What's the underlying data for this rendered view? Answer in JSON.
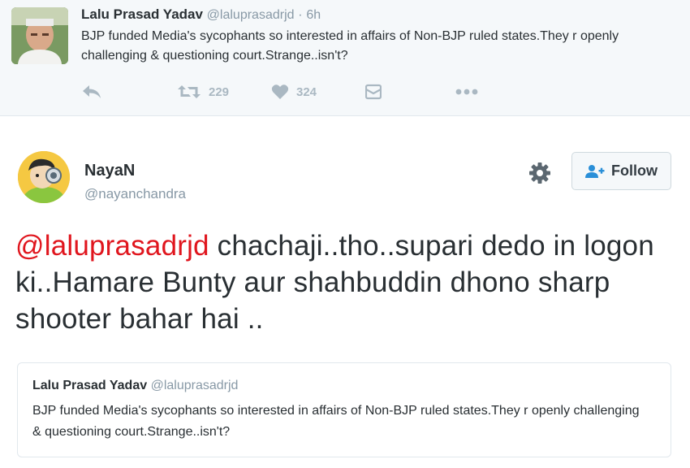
{
  "top_tweet": {
    "name": "Lalu Prasad Yadav",
    "handle": "@laluprasadrjd",
    "separator": "·",
    "time": "6h",
    "text": "BJP funded Media's sycophants so interested in affairs of Non-BJP ruled states.They r openly challenging & questioning court.Strange..isn't?",
    "actions": {
      "reply_icon": "reply-icon",
      "retweet_icon": "retweet-icon",
      "retweet_count": "229",
      "like_icon": "heart-icon",
      "like_count": "324",
      "dm_icon": "direct-message-icon",
      "more_icon": "more-icon"
    }
  },
  "main_tweet": {
    "name": "NayaN",
    "handle": "@nayanchandra",
    "mention": "@laluprasadrjd",
    "text": " chachaji..tho..supari dedo in logon ki..Hamare Bunty aur shahbuddin dhono sharp shooter bahar hai ..",
    "gear_icon": "gear-icon",
    "follow_label": "Follow",
    "follow_icon": "add-user-icon"
  },
  "quoted_tweet": {
    "name": "Lalu Prasad Yadav",
    "handle": "@laluprasadrjd",
    "text": "BJP funded Media's sycophants so interested in affairs of Non-BJP ruled states.They r openly challenging & questioning court.Strange..isn't?"
  },
  "colors": {
    "mention": "#e0161e",
    "muted": "#8899a6",
    "icon": "#aab8c2",
    "card_bg": "#f5f8fa"
  }
}
